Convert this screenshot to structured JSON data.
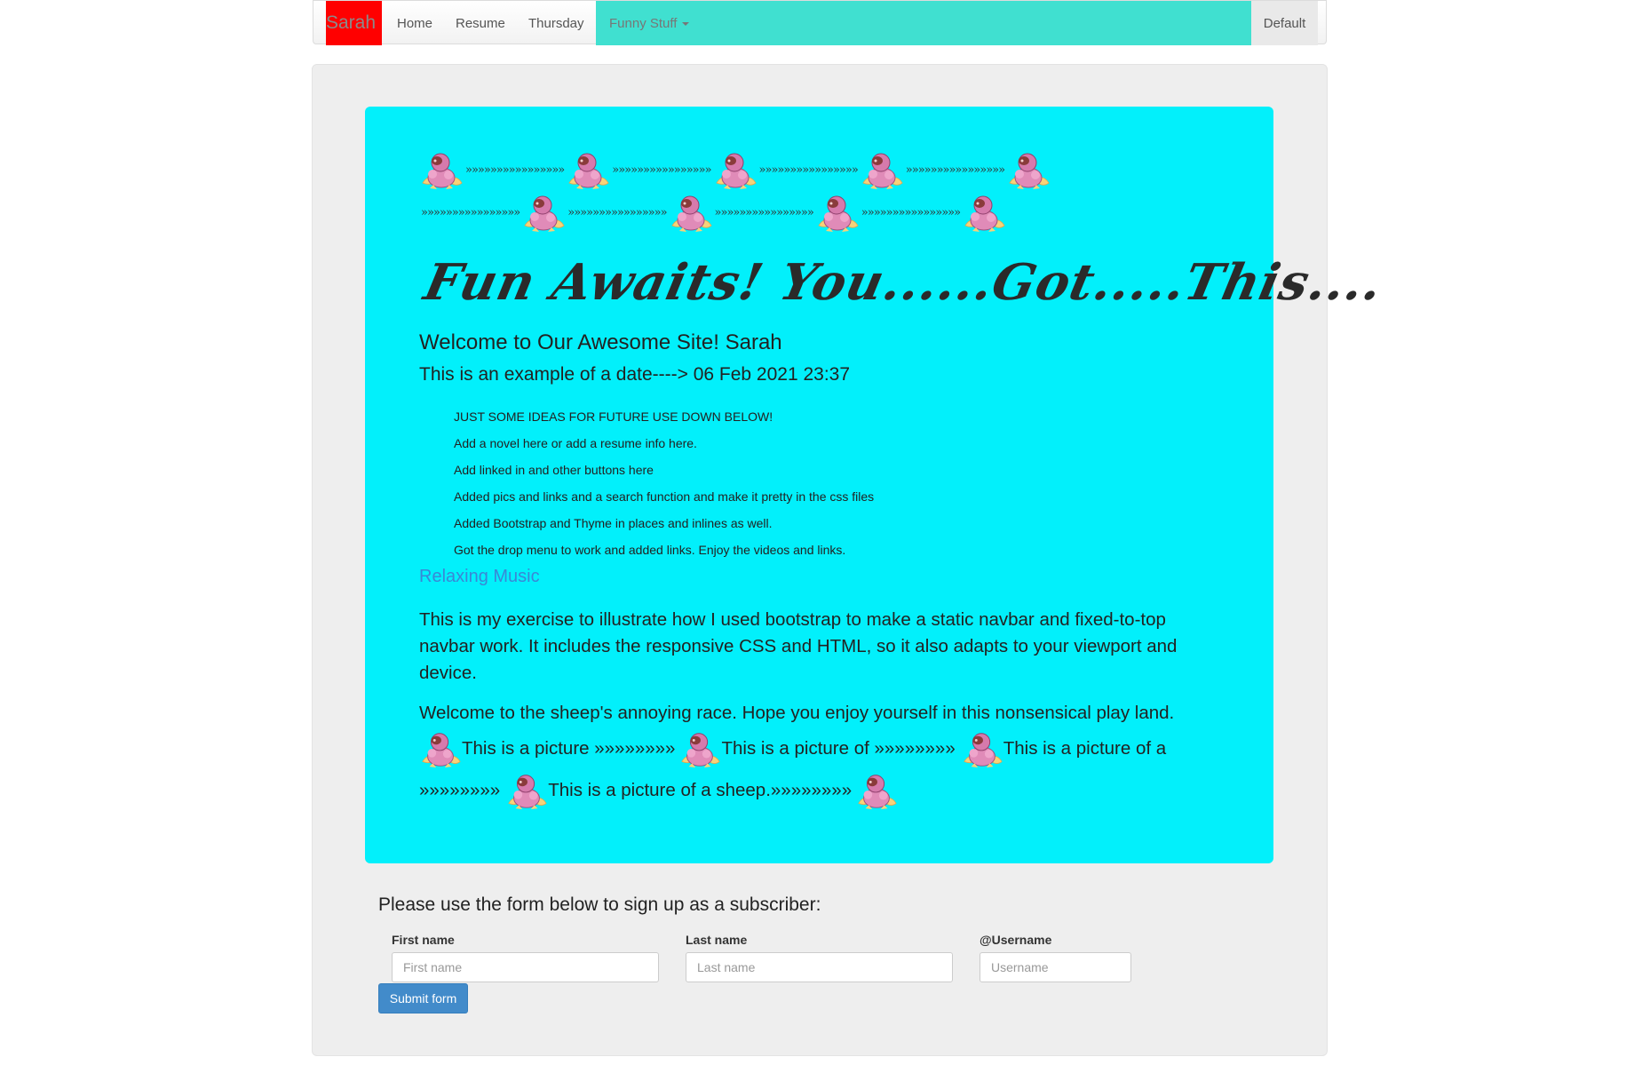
{
  "navbar": {
    "brand": "Sarah",
    "links": [
      "Home",
      "Resume",
      "Thursday"
    ],
    "dropdown": "Funny Stuff",
    "right": "Default"
  },
  "hero": {
    "chevrons": "»»»»»»»»»»»»»»»»",
    "title": "Fun Awaits! You......Got.....This....",
    "welcome": "Welcome to Our Awesome Site! Sarah",
    "date_line": "This is an example of a date----> 06 Feb 2021 23:37",
    "ideas": [
      "JUST SOME IDEAS FOR FUTURE USE DOWN BELOW!",
      "Add a novel here or add a resume info here.",
      "Add linked in and other buttons here",
      "Added pics and links and a search function and make it pretty in the css files",
      "Added Bootstrap and Thyme in places and inlines as well.",
      "Got the drop menu to work and added links. Enjoy the videos and links."
    ],
    "music_link": "Relaxing Music",
    "paragraph": "This is my exercise to illustrate how I used bootstrap to make a static navbar and fixed-to-top navbar work. It includes the responsive CSS and HTML, so it also adapts to your viewport and device.",
    "sheep_race": "Welcome to the sheep's annoying race. Hope you enjoy yourself in this nonsensical play land.",
    "pics": {
      "p1": "This is a picture »»»»»»»»",
      "p2": "This is a picture of »»»»»»»»",
      "p3": "This is a picture of a",
      "p4": "»»»»»»»»",
      "p5": "This is a picture of a sheep.»»»»»»»»"
    }
  },
  "form": {
    "intro": "Please use the form below to sign up as a subscriber:",
    "first_label": "First name",
    "first_placeholder": "First name",
    "last_label": "Last name",
    "last_placeholder": "Last name",
    "user_label": "@Username",
    "user_placeholder": "Username",
    "submit": "Submit form"
  },
  "colors": {
    "brand_bg": "#ff0000",
    "dropdown_bg": "#40e0d0",
    "hero_bg": "#02f0fb",
    "jumbotron_bg": "#eeeeee",
    "link": "#3a87d6",
    "button": "#428bca"
  }
}
